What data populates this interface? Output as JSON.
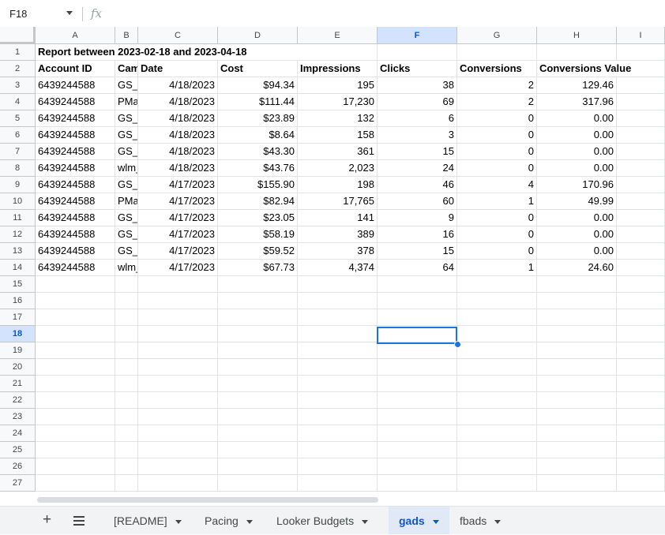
{
  "formula_bar": {
    "name_box": "F18",
    "fx_label": "fx",
    "formula": ""
  },
  "columns": [
    "A",
    "B",
    "C",
    "D",
    "E",
    "F",
    "G",
    "H",
    "I"
  ],
  "active_column": "F",
  "active_row": 18,
  "row_numbers": [
    "1",
    "2",
    "3",
    "4",
    "5",
    "6",
    "7",
    "8",
    "9",
    "10",
    "11",
    "12",
    "13",
    "14",
    "15",
    "16",
    "17",
    "18",
    "19",
    "20",
    "21",
    "22",
    "23",
    "24",
    "25",
    "26",
    "27"
  ],
  "title_cell": "Report between 2023-02-18 and 2023-04-18",
  "headers": [
    "Account ID",
    "Cam",
    "Date",
    "Cost",
    "Impressions",
    "Clicks",
    "Conversions",
    "Conversions Value"
  ],
  "rows": [
    [
      "6439244588",
      "GS_",
      "4/18/2023",
      "$94.34",
      "195",
      "38",
      "2",
      "129.46"
    ],
    [
      "6439244588",
      "PMa",
      "4/18/2023",
      "$111.44",
      "17,230",
      "69",
      "2",
      "317.96"
    ],
    [
      "6439244588",
      "GS_",
      "4/18/2023",
      "$23.89",
      "132",
      "6",
      "0",
      "0.00"
    ],
    [
      "6439244588",
      "GS_",
      "4/18/2023",
      "$8.64",
      "158",
      "3",
      "0",
      "0.00"
    ],
    [
      "6439244588",
      "GS_",
      "4/18/2023",
      "$43.30",
      "361",
      "15",
      "0",
      "0.00"
    ],
    [
      "6439244588",
      "wlm_",
      "4/18/2023",
      "$43.76",
      "2,023",
      "24",
      "0",
      "0.00"
    ],
    [
      "6439244588",
      "GS_",
      "4/17/2023",
      "$155.90",
      "198",
      "46",
      "4",
      "170.96"
    ],
    [
      "6439244588",
      "PMa",
      "4/17/2023",
      "$82.94",
      "17,765",
      "60",
      "1",
      "49.99"
    ],
    [
      "6439244588",
      "GS_",
      "4/17/2023",
      "$23.05",
      "141",
      "9",
      "0",
      "0.00"
    ],
    [
      "6439244588",
      "GS_",
      "4/17/2023",
      "$58.19",
      "389",
      "16",
      "0",
      "0.00"
    ],
    [
      "6439244588",
      "GS_",
      "4/17/2023",
      "$59.52",
      "378",
      "15",
      "0",
      "0.00"
    ],
    [
      "6439244588",
      "wlm_",
      "4/17/2023",
      "$67.73",
      "4,374",
      "64",
      "1",
      "24.60"
    ]
  ],
  "sheet_tabs": [
    {
      "label": "[README]",
      "active": false
    },
    {
      "label": "Pacing",
      "active": false
    },
    {
      "label": "Looker Budgets",
      "active": false
    },
    {
      "label": "gads",
      "active": true
    },
    {
      "label": "fbads",
      "active": false
    }
  ],
  "colors": {
    "accent": "#1a73e8",
    "active_header_bg": "#d3e3fd",
    "active_tab_bg": "#e1e9f7"
  },
  "icons": {
    "add_sheet": "plus-icon",
    "all_sheets": "menu-icon",
    "tab_menu": "caret-down-icon"
  }
}
